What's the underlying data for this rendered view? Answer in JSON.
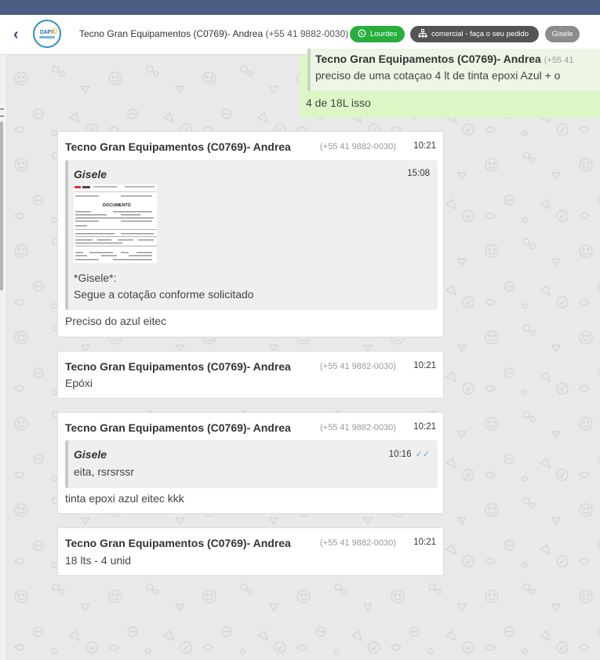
{
  "header": {
    "back_label": "‹",
    "logo_text": "DAPX",
    "contact_name": "Tecno Gran Equipamentos (C0769)- Andrea",
    "contact_phone": "(+55 41 9882-0030)",
    "chips": {
      "agent": "Lourdes",
      "queue": "comercial - faça o seu pedido",
      "user": "Gisele"
    },
    "colors": {
      "agent_chip": "#27ae3d",
      "queue_chip": "#545454",
      "user_chip": "#8c8c8c",
      "top_strip": "#4e5d83"
    }
  },
  "outgoing": {
    "quote_sender": "Tecno Gran Equipamentos (C0769)- Andrea",
    "quote_phone": "(+55 41",
    "quote_text": "preciso de uma cotaçao 4 lt de tinta epoxi Azul + o",
    "text": "4 de 18L isso"
  },
  "messages": [
    {
      "sender": "Tecno Gran Equipamentos (C0769)- Andrea",
      "phone": "(+55 41 9882-0030)",
      "time": "10:21",
      "quote": {
        "sender": "Gisele",
        "time": "15:08",
        "attachment_title": "DOCUMENTO",
        "lines": [
          "*Gisele*:",
          "Segue a cotação conforme solicitado"
        ]
      },
      "text": "Preciso do azul eitec"
    },
    {
      "sender": "Tecno Gran Equipamentos (C0769)- Andrea",
      "phone": "(+55 41 9882-0030)",
      "time": "10:21",
      "text": "Epóxi"
    },
    {
      "sender": "Tecno Gran Equipamentos (C0769)- Andrea",
      "phone": "(+55 41 9882-0030)",
      "time": "10:21",
      "quote": {
        "sender": "Gisele",
        "time": "10:16",
        "tick": "✓✓",
        "lines": [
          "eita, rsrsrssr"
        ]
      },
      "text": "tinta epoxi azul eitec kkk"
    },
    {
      "sender": "Tecno Gran Equipamentos (C0769)- Andrea",
      "phone": "(+55 41 9882-0030)",
      "time": "10:21",
      "text": "18 lts - 4 unid"
    }
  ]
}
